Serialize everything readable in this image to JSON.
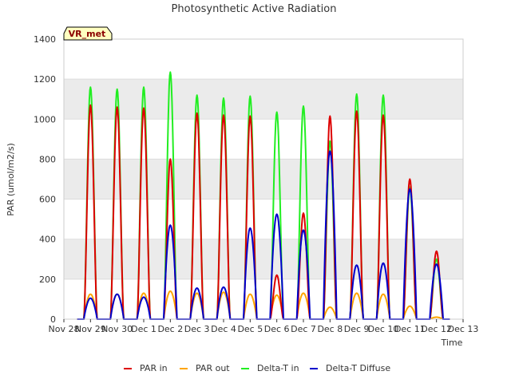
{
  "chart_data": {
    "type": "line",
    "title": "Photosynthetic Active Radiation",
    "xlabel": "Time",
    "ylabel": "PAR (umol/m2/s)",
    "badge": "VR_met",
    "ylim": [
      0,
      1400
    ],
    "xlim": [
      0,
      15
    ],
    "yticks": [
      0,
      200,
      400,
      600,
      800,
      1000,
      1200,
      1400
    ],
    "xtick_labels": [
      "Nov 28",
      "Nov 29",
      "Nov 30",
      "Dec 1",
      "Dec 2",
      "Dec 3",
      "Dec 4",
      "Dec 5",
      "Dec 6",
      "Dec 7",
      "Dec 8",
      "Dec 9",
      "Dec 10",
      "Dec 11",
      "Dec 12",
      "Dec 13"
    ],
    "grid": true,
    "legend_position": "bottom",
    "colors": {
      "par_in": "#dd0000",
      "par_out": "#ffa500",
      "delta_t_in": "#22ee22",
      "delta_t_diffuse": "#0000cc",
      "band": "#ebebeb",
      "badge_bg": "#ffffc0"
    },
    "series": [
      {
        "name": "PAR in",
        "color_key": "par_in",
        "daily_peaks": [
          1070,
          1060,
          1055,
          800,
          1030,
          1020,
          1015,
          220,
          530,
          1015,
          1040,
          1020,
          700,
          340
        ]
      },
      {
        "name": "PAR out",
        "color_key": "par_out",
        "daily_peaks": [
          125,
          125,
          130,
          140,
          130,
          135,
          125,
          120,
          130,
          60,
          130,
          125,
          65,
          10
        ]
      },
      {
        "name": "Delta-T in",
        "color_key": "delta_t_in",
        "daily_peaks": [
          1160,
          1150,
          1160,
          1235,
          1120,
          1105,
          1115,
          1035,
          1065,
          890,
          1125,
          1120,
          660,
          300
        ]
      },
      {
        "name": "Delta-T Diffuse",
        "color_key": "delta_t_diffuse",
        "daily_peaks": [
          105,
          125,
          110,
          470,
          155,
          160,
          455,
          525,
          445,
          840,
          270,
          280,
          650,
          275
        ]
      }
    ]
  }
}
